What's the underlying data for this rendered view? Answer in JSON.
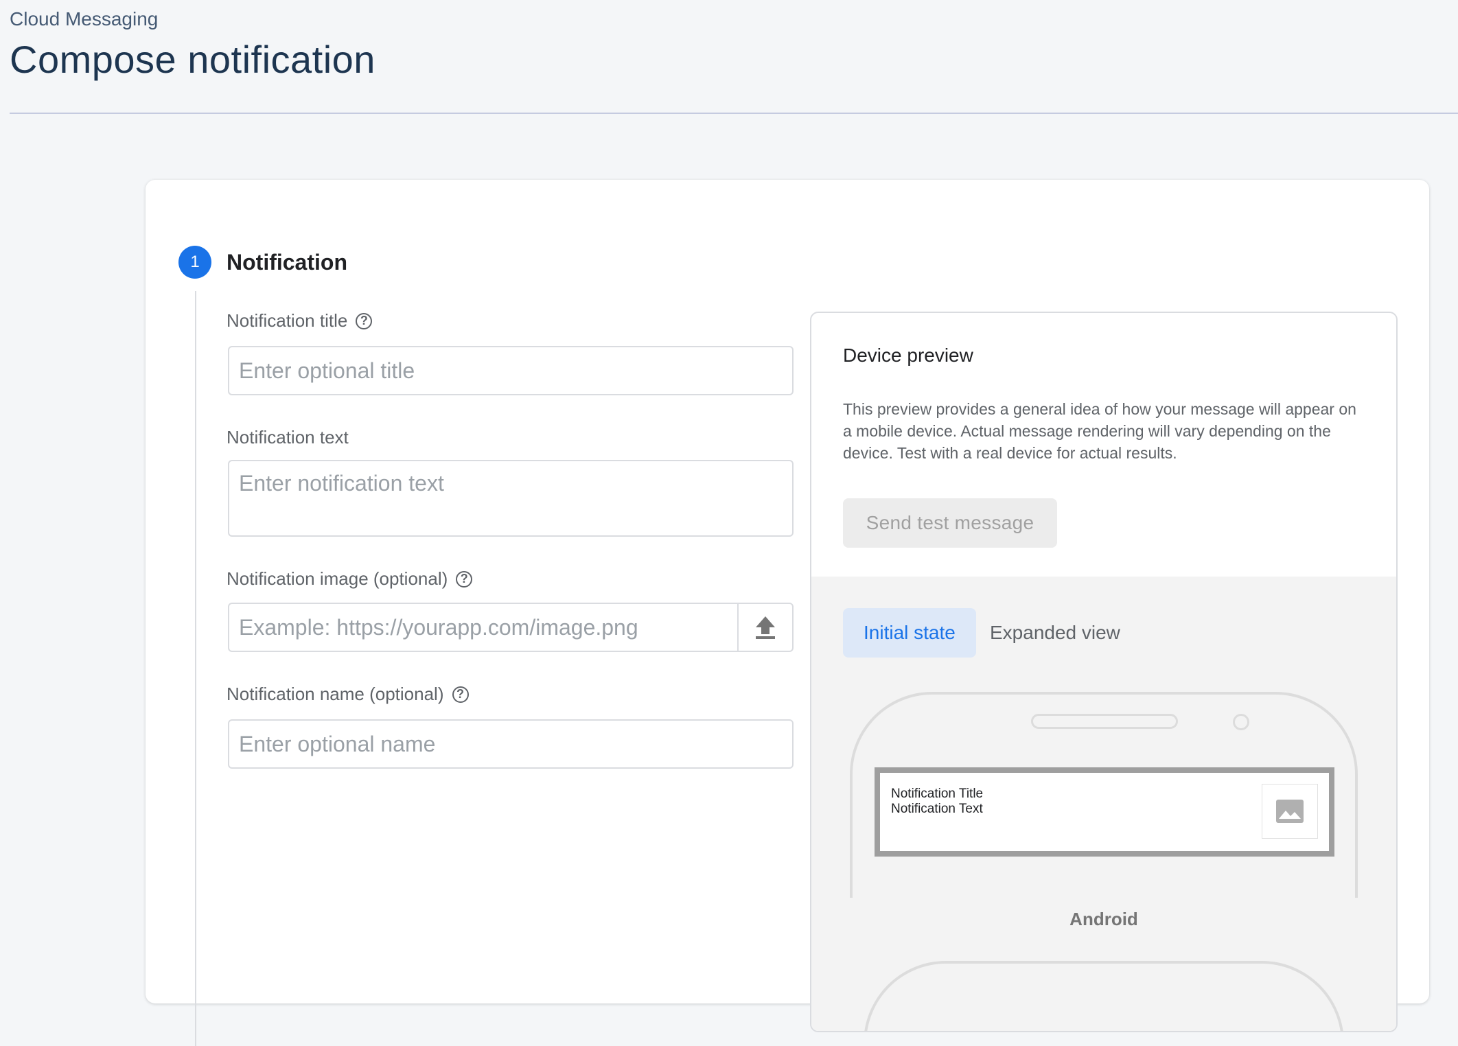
{
  "header": {
    "breadcrumb": "Cloud Messaging",
    "title": "Compose notification"
  },
  "step": {
    "number": "1",
    "title": "Notification"
  },
  "fields": {
    "title": {
      "label": "Notification title",
      "placeholder": "Enter optional title",
      "value": ""
    },
    "text": {
      "label": "Notification text",
      "placeholder": "Enter notification text",
      "value": ""
    },
    "image": {
      "label": "Notification image (optional)",
      "placeholder": "Example: https://yourapp.com/image.png",
      "value": ""
    },
    "name": {
      "label": "Notification name (optional)",
      "placeholder": "Enter optional name",
      "value": ""
    }
  },
  "preview": {
    "title": "Device preview",
    "description": "This preview provides a general idea of how your message will appear on a mobile device. Actual message rendering will vary depending on the device. Test with a real device for actual results.",
    "send_label": "Send test message",
    "tabs": [
      {
        "label": "Initial state",
        "active": true
      },
      {
        "label": "Expanded view",
        "active": false
      }
    ],
    "notification": {
      "title": "Notification Title",
      "text": "Notification Text"
    },
    "platform": "Android"
  },
  "colors": {
    "accent": "#1a73e8",
    "title": "#1d3550",
    "background": "#f4f6f8"
  },
  "icons": {
    "help": "help-circle-icon",
    "upload": "upload-icon",
    "image_placeholder": "image-icon"
  }
}
